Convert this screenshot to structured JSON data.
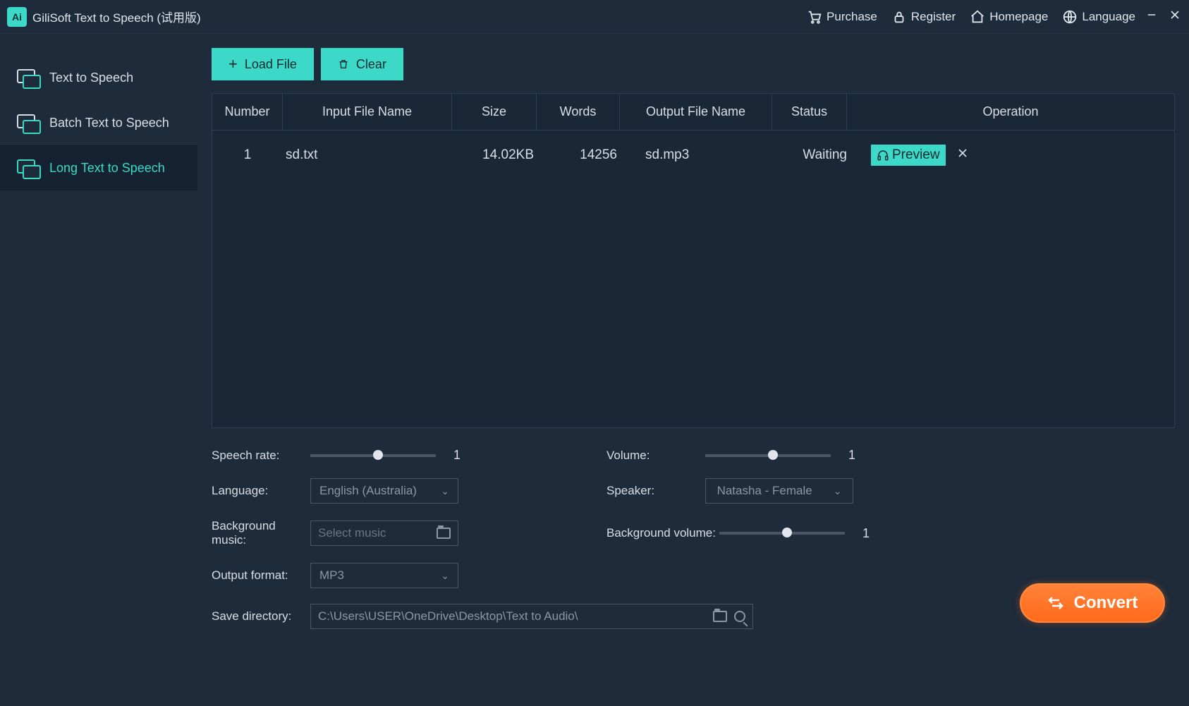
{
  "titlebar": {
    "app_title": "GiliSoft Text to Speech (试用版)",
    "links": {
      "purchase": "Purchase",
      "register": "Register",
      "homepage": "Homepage",
      "language": "Language"
    }
  },
  "sidebar": {
    "items": [
      {
        "label": "Text to Speech"
      },
      {
        "label": "Batch Text to Speech"
      },
      {
        "label": "Long Text to Speech"
      }
    ]
  },
  "actions": {
    "load_file": "Load File",
    "clear": "Clear"
  },
  "table": {
    "headers": {
      "number": "Number",
      "input_file": "Input File Name",
      "size": "Size",
      "words": "Words",
      "output_file": "Output File Name",
      "status": "Status",
      "operation": "Operation"
    },
    "rows": [
      {
        "number": "1",
        "input_file": "sd.txt",
        "size": "14.02KB",
        "words": "14256",
        "output_file": "sd.mp3",
        "status": "Waiting",
        "preview_label": "Preview"
      }
    ]
  },
  "settings": {
    "speech_rate_label": "Speech rate:",
    "speech_rate_value": "1",
    "volume_label": "Volume:",
    "volume_value": "1",
    "language_label": "Language:",
    "language_value": "English (Australia)",
    "speaker_label": "Speaker:",
    "speaker_value": "Natasha - Female",
    "bg_music_label": "Background music:",
    "bg_music_placeholder": "Select music",
    "bg_volume_label": "Background volume:",
    "bg_volume_value": "1",
    "output_format_label": "Output format:",
    "output_format_value": "MP3",
    "save_dir_label": "Save directory:",
    "save_dir_value": "C:\\Users\\USER\\OneDrive\\Desktop\\Text to Audio\\"
  },
  "convert_label": "Convert"
}
